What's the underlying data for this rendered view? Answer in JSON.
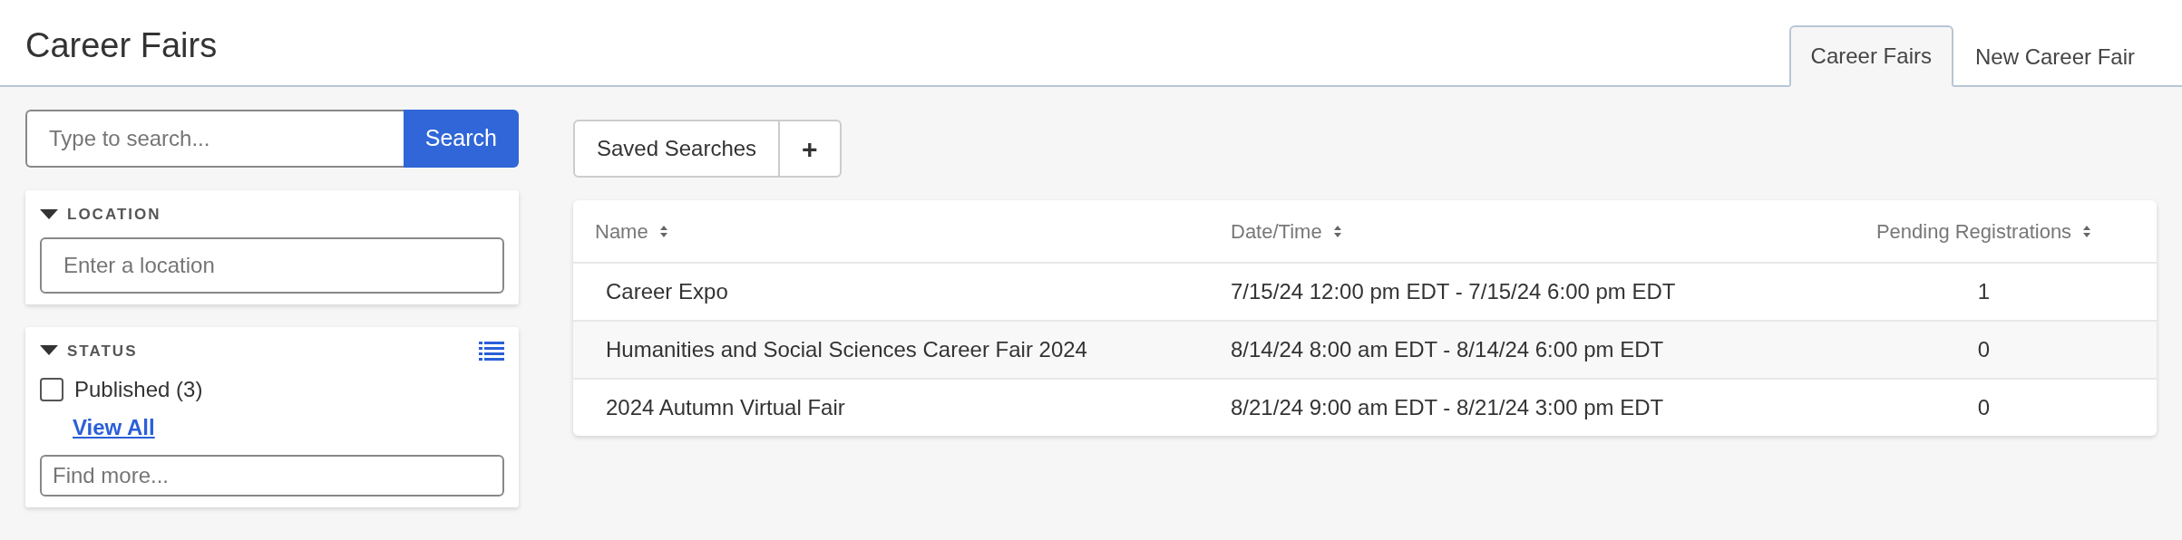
{
  "page_title": "Career Fairs",
  "tabs": [
    {
      "label": "Career Fairs",
      "selected": true
    },
    {
      "label": "New Career Fair",
      "selected": false
    }
  ],
  "search": {
    "placeholder": "Type to search...",
    "button": "Search"
  },
  "filters": [
    {
      "kind": "location",
      "title": "LOCATION",
      "placeholder": "Enter a location",
      "expanded": true
    },
    {
      "kind": "status",
      "title": "STATUS",
      "expanded": true,
      "options": [
        {
          "label": "Published (3)",
          "checked": false
        }
      ],
      "view_all": "View All",
      "find_placeholder": "Find more..."
    }
  ],
  "saved_searches": {
    "label": "Saved Searches",
    "add": "+"
  },
  "table": {
    "columns": [
      "Name",
      "Date/Time",
      "Pending Registrations"
    ],
    "rows": [
      [
        "Career Expo",
        "7/15/24 12:00 pm EDT - 7/15/24 6:00 pm EDT",
        "1"
      ],
      [
        "Humanities and Social Sciences Career Fair 2024",
        "8/14/24 8:00 am EDT - 8/14/24 6:00 pm EDT",
        "0"
      ],
      [
        "2024 Autumn Virtual Fair",
        "8/21/24 9:00 am EDT - 8/21/24 3:00 pm EDT",
        "0"
      ]
    ]
  }
}
